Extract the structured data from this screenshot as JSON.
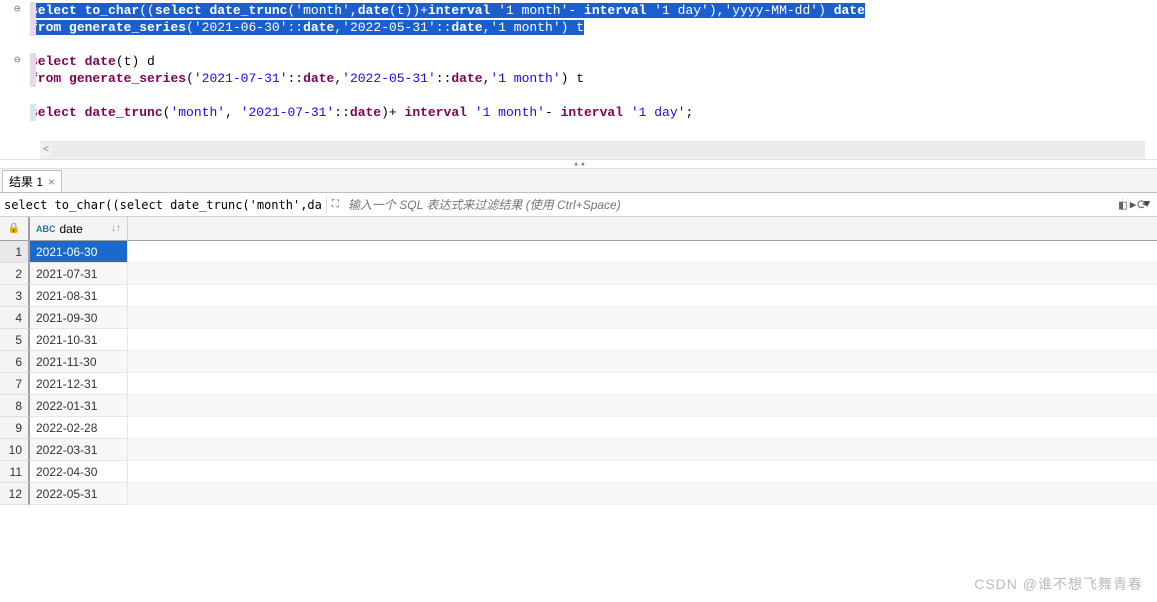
{
  "editor": {
    "block1": {
      "line1_parts": [
        "select",
        " ",
        "to_char",
        "((",
        "select",
        " ",
        "date_trunc",
        "(",
        "'month'",
        ",",
        "date",
        "(t))+",
        "interval",
        " ",
        "'1 month'",
        "- ",
        "interval",
        " ",
        "'1 day'",
        "),",
        "'yyyy-MM-dd'",
        ") ",
        "date"
      ],
      "line2_parts": [
        "from",
        " ",
        "generate_series",
        "(",
        "'2021-06-30'",
        "::",
        "date",
        ",",
        "'2022-05-31'",
        "::",
        "date",
        ",",
        "'1 month'",
        ") t"
      ]
    },
    "block2": {
      "line1_parts": [
        "select",
        " ",
        "date",
        "(t) d"
      ],
      "line2_parts": [
        "from",
        " ",
        "generate_series",
        "(",
        "'2021-07-31'",
        "::",
        "date",
        ",",
        "'2022-05-31'",
        "::",
        "date",
        ",",
        "'1 month'",
        ") t"
      ]
    },
    "block3": {
      "line1_parts": [
        "select",
        " ",
        "date_trunc",
        "(",
        "'month'",
        ", ",
        "'2021-07-31'",
        "::",
        "date",
        ")+ ",
        "interval",
        " ",
        "'1 month'",
        "- ",
        "interval",
        " ",
        "'1 day'",
        ";"
      ]
    }
  },
  "tabs": {
    "result_label": "结果 1"
  },
  "filter": {
    "expr": "select to_char((select date_trunc('month',da",
    "placeholder": "输入一个 SQL 表达式来过滤结果 (使用 Ctrl+Space)"
  },
  "table": {
    "col_type": "ABC",
    "col_name": "date",
    "rows": [
      {
        "n": "1",
        "v": "2021-06-30"
      },
      {
        "n": "2",
        "v": "2021-07-31"
      },
      {
        "n": "3",
        "v": "2021-08-31"
      },
      {
        "n": "4",
        "v": "2021-09-30"
      },
      {
        "n": "5",
        "v": "2021-10-31"
      },
      {
        "n": "6",
        "v": "2021-11-30"
      },
      {
        "n": "7",
        "v": "2021-12-31"
      },
      {
        "n": "8",
        "v": "2022-01-31"
      },
      {
        "n": "9",
        "v": "2022-02-28"
      },
      {
        "n": "10",
        "v": "2022-03-31"
      },
      {
        "n": "11",
        "v": "2022-04-30"
      },
      {
        "n": "12",
        "v": "2022-05-31"
      }
    ]
  },
  "watermark": "CSDN @谁不想飞舞青春"
}
